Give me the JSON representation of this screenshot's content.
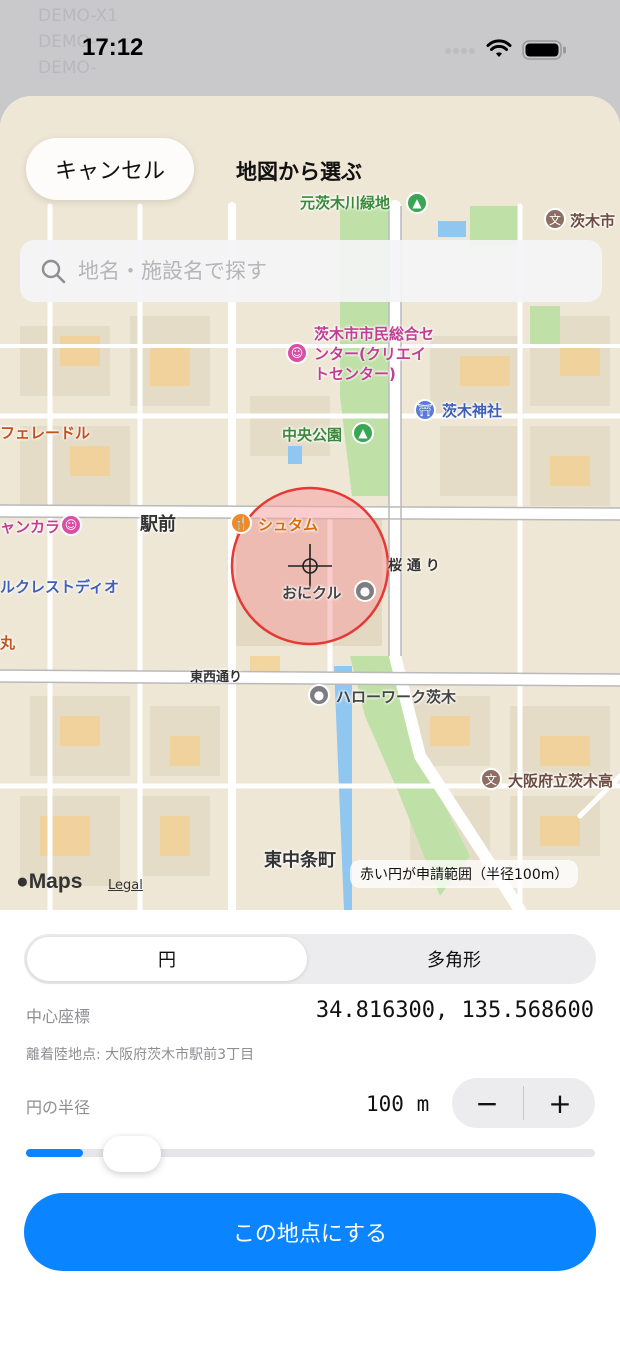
{
  "status": {
    "time": "17:12"
  },
  "background_rows": [
    "DEMO-X1",
    "DEMO-",
    "DEMO-"
  ],
  "header": {
    "cancel_label": "キャンセル",
    "title": "地図から選ぶ"
  },
  "search": {
    "placeholder": "地名・施設名で探す"
  },
  "map": {
    "pois": {
      "park_moto": "元茨木川緑地",
      "school_ibaraki": "茨木市",
      "civic_center": "茨木市市民総合セ\nンター(クリエイ\nトセンター)",
      "shrine": "茨木神社",
      "chuo_park": "中央公園",
      "feredor": "フェレードル",
      "ekimae": "駅前",
      "shutamu": "シュタム",
      "yankara": "ャンカラ",
      "crest": "ルクレストディオ",
      "maru": "丸",
      "onikuru": "おにクル",
      "hellowork": "ハローワーク茨木",
      "school_osaka": "大阪府立茨木高",
      "higashi": "東中条町"
    },
    "roads": {
      "tozai": "東西通り",
      "sakura": "桜\n通\nり"
    },
    "attribution_note": "赤い円が申請範囲（半径100m）",
    "logo_text": "Maps",
    "legal": "Legal"
  },
  "shape_selector": {
    "circle": "円",
    "polygon": "多角形",
    "selected": "circle"
  },
  "center": {
    "label": "中心座標",
    "value": "34.816300, 135.568600",
    "address": "離着陸地点: 大阪府茨木市駅前3丁目"
  },
  "radius": {
    "label": "円の半径",
    "value": "100 m",
    "minus": "−",
    "plus": "+",
    "slider_fraction": 0.1
  },
  "confirm_label": "この地点にする",
  "colors": {
    "accent": "#0a84ff",
    "circle_fill": "#f5a3a3",
    "circle_stroke": "#e53935"
  }
}
